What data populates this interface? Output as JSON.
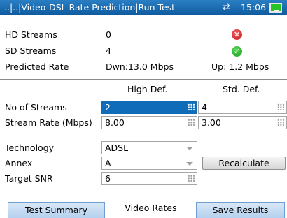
{
  "titlebar": {
    "title": "..|..|Video-DSL Rate Prediction|Run Test",
    "time": "15:06",
    "network_icon": "network-sync-icon",
    "battery_icon": "battery-icon"
  },
  "summary": {
    "hd_label": "HD Streams",
    "hd_value": "0",
    "hd_status": "fail",
    "sd_label": "SD Streams",
    "sd_value": "4",
    "sd_status": "pass",
    "rate_label": "Predicted Rate",
    "rate_down": "Dwn:13.0 Mbps",
    "rate_up": "Up: 1.2 Mbps"
  },
  "config": {
    "col_high": "High Def.",
    "col_std": "Std. Def.",
    "streams_label": "No of Streams",
    "streams_high": "2",
    "streams_std": "4",
    "rate_label": "Stream Rate (Mbps)",
    "rate_high": "8.00",
    "rate_std": "3.00",
    "technology_label": "Technology",
    "technology_value": "ADSL",
    "annex_label": "Annex",
    "annex_value": "A",
    "snr_label": "Target SNR",
    "snr_value": "6",
    "recalculate_label": "Recalculate"
  },
  "tabs": [
    {
      "label": "Test Summary",
      "active": false
    },
    {
      "label": "Video Rates",
      "active": true
    },
    {
      "label": "Save Results",
      "active": false
    }
  ],
  "colors": {
    "titlebar": "#1668b0",
    "selected_field": "#0e6cb8",
    "fail": "#d62020",
    "pass": "#22a822",
    "tab": "#c5dcf2"
  }
}
